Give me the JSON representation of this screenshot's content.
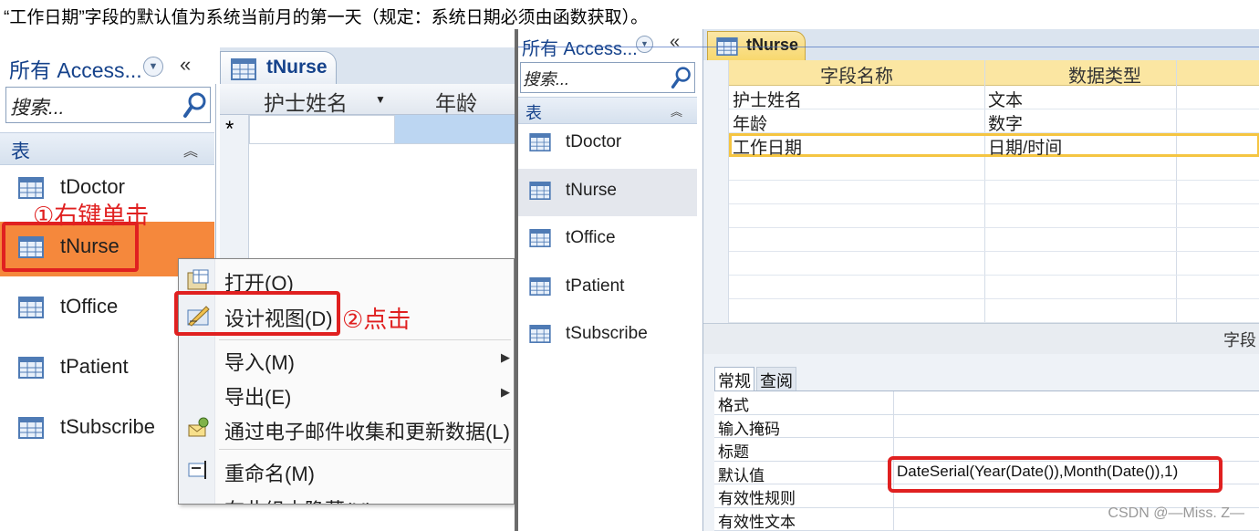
{
  "instruction": "“工作日期”字段的默认值为系统当前月的第一天（规定：系统日期必须由函数获取）。",
  "left": {
    "nav_title": "所有 Access...",
    "search_placeholder": "搜索...",
    "group_label": "表",
    "items": [
      "tDoctor",
      "tNurse",
      "tOffice",
      "tPatient",
      "tSubscribe"
    ],
    "selected_item": "tNurse",
    "step1_note": "①右键单击",
    "datasheet": {
      "tab_label": "tNurse",
      "col1": "护士姓名",
      "col2": "年龄",
      "new_row_marker": "*"
    },
    "context_menu": {
      "open": "打开(O)",
      "design_view": "设计视图(D)",
      "import": "导入(M)",
      "export": "导出(E)",
      "email_collect": "通过电子邮件收集和更新数据(L)",
      "rename": "重命名(M)",
      "hide": "在此组中隐藏(H)"
    },
    "step2_note": "②点击"
  },
  "right": {
    "nav_title": "所有 Access...",
    "search_placeholder": "搜索...",
    "group_label": "表",
    "items": [
      "tDoctor",
      "tNurse",
      "tOffice",
      "tPatient",
      "tSubscribe"
    ],
    "tab_label": "tNurse",
    "grid": {
      "header_name": "字段名称",
      "header_type": "数据类型",
      "rows": [
        {
          "name": "护士姓名",
          "type": "文本"
        },
        {
          "name": "年龄",
          "type": "数字"
        },
        {
          "name": "工作日期",
          "type": "日期/时间"
        }
      ]
    },
    "field_props_label": "字段",
    "prop_tabs": {
      "general": "常规",
      "lookup": "查阅"
    },
    "props": [
      {
        "name": "格式",
        "value": ""
      },
      {
        "name": "输入掩码",
        "value": ""
      },
      {
        "name": "标题",
        "value": ""
      },
      {
        "name": "默认值",
        "value": "DateSerial(Year(Date()),Month(Date()),1)"
      },
      {
        "name": "有效性规则",
        "value": ""
      },
      {
        "name": "有效性文本",
        "value": ""
      }
    ]
  },
  "watermark": "CSDN @—Miss. Z—",
  "colors": {
    "accent_orange": "#f5883c",
    "annotation_red": "#e02020",
    "header_yellow": "#fbe6a2",
    "access_blue": "#15428b"
  }
}
